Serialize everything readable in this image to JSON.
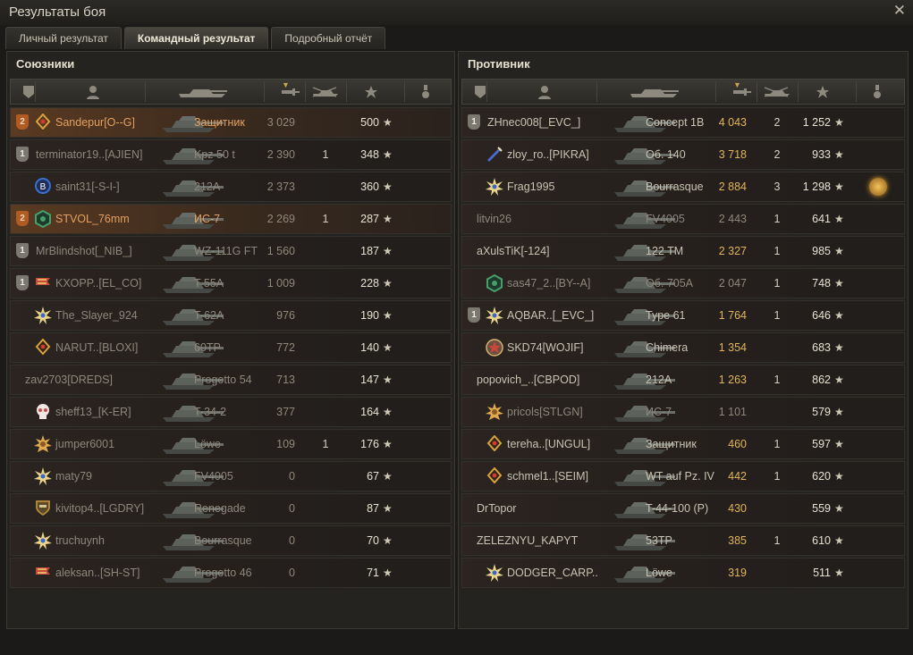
{
  "window": {
    "title": "Результаты боя",
    "close_glyph": "✕"
  },
  "tabs": [
    "Личный результат",
    "Командный результат",
    "Подробный отчёт"
  ],
  "active_tab": 1,
  "colors": {
    "accent_orange": "#e4a060",
    "damage_highlight": "#e0b55c",
    "platoon_orange": "#b05a24"
  },
  "header_icons": [
    "platoon-icon",
    "player-icon",
    "tank-icon",
    "damage-icon",
    "kills-icon",
    "xp-star-icon",
    "medal-icon"
  ],
  "allies": {
    "title": "Союзники",
    "rows": [
      {
        "platoon": "2",
        "pcolor": "orange",
        "clan_icon": "diamond-icon",
        "name": "Sandepur[O--G]",
        "vehicle": "Защитник",
        "damage": "3 029",
        "kills": "",
        "xp": "500",
        "me": true,
        "dead": false
      },
      {
        "platoon": "1",
        "pcolor": "gray",
        "clan_icon": "",
        "name": "terminator19..[AJIEN]",
        "vehicle": "Kpz 50 t",
        "damage": "2 390",
        "kills": "1",
        "xp": "348",
        "dead": true
      },
      {
        "platoon": "",
        "clan_icon": "b-circle-icon",
        "name": "saint31[-S-I-]",
        "vehicle": "212A",
        "damage": "2 373",
        "kills": "",
        "xp": "360",
        "dead": true
      },
      {
        "platoon": "2",
        "pcolor": "orange",
        "clan_icon": "hexagon-icon",
        "name": "STVOL_76mm",
        "vehicle": "ИС-7",
        "damage": "2 269",
        "kills": "1",
        "xp": "287",
        "me": true,
        "dead": false
      },
      {
        "platoon": "1",
        "pcolor": "gray",
        "clan_icon": "",
        "name": "MrBlindshot[_NIB_]",
        "vehicle": "WZ-111G FT",
        "damage": "1 560",
        "kills": "",
        "xp": "187",
        "dead": true
      },
      {
        "platoon": "1",
        "pcolor": "gray",
        "clan_icon": "flag-icon",
        "name": "KXOPP..[EL_CO]",
        "vehicle": "T 55A",
        "damage": "1 009",
        "kills": "",
        "xp": "228",
        "dead": true
      },
      {
        "platoon": "",
        "clan_icon": "star-burst-icon",
        "name": "The_Slayer_924",
        "vehicle": "T-62A",
        "damage": "976",
        "kills": "",
        "xp": "190",
        "dead": true
      },
      {
        "platoon": "",
        "clan_icon": "diamond-icon",
        "name": "NARUT..[BLOXI]",
        "vehicle": "60TP",
        "damage": "772",
        "kills": "",
        "xp": "140",
        "dead": true
      },
      {
        "platoon": "",
        "clan_icon": "",
        "name": "zav2703[DREDS]",
        "vehicle": "Progetto 54",
        "damage": "713",
        "kills": "",
        "xp": "147",
        "dead": true
      },
      {
        "platoon": "",
        "clan_icon": "skull-icon",
        "name": "sheff13_[K-ER]",
        "vehicle": "T-34-2",
        "damage": "377",
        "kills": "",
        "xp": "164",
        "dead": true
      },
      {
        "platoon": "",
        "clan_icon": "sun-icon",
        "name": "jumper6001",
        "vehicle": "Löwe",
        "damage": "109",
        "kills": "1",
        "xp": "176",
        "dead": true
      },
      {
        "platoon": "",
        "clan_icon": "star-burst-icon",
        "name": "maty79",
        "vehicle": "FV4005",
        "damage": "0",
        "kills": "",
        "xp": "67",
        "dead": true
      },
      {
        "platoon": "",
        "clan_icon": "shield-icon",
        "name": "kivitop4..[LGDRY]",
        "vehicle": "Renegade",
        "damage": "0",
        "kills": "",
        "xp": "87",
        "dead": true
      },
      {
        "platoon": "",
        "clan_icon": "star-burst-icon",
        "name": "truchuynh",
        "vehicle": "Bourrasque",
        "damage": "0",
        "kills": "",
        "xp": "70",
        "dead": true
      },
      {
        "platoon": "",
        "clan_icon": "flag-icon",
        "name": "aleksan..[SH-ST]",
        "vehicle": "Progetto 46",
        "damage": "0",
        "kills": "",
        "xp": "71",
        "dead": true
      }
    ]
  },
  "enemies": {
    "title": "Противник",
    "rows": [
      {
        "platoon": "1",
        "pcolor": "gray",
        "clan_icon": "",
        "name": "ZHnec008[_EVC_]",
        "vehicle": "Concept 1B",
        "damage": "4 043",
        "kills": "2",
        "xp": "1 252",
        "dmg_hi": true
      },
      {
        "platoon": "",
        "clan_icon": "rocket-icon",
        "name": "zloy_ro..[PIKRA]",
        "vehicle": "Об. 140",
        "damage": "3 718",
        "kills": "2",
        "xp": "933",
        "dmg_hi": true
      },
      {
        "platoon": "",
        "clan_icon": "star-burst-icon",
        "name": "Frag1995",
        "vehicle": "Bourrasque",
        "damage": "2 884",
        "kills": "3",
        "xp": "1 298",
        "dmg_hi": true,
        "medal": true
      },
      {
        "platoon": "",
        "clan_icon": "",
        "name": "litvin26",
        "vehicle": "FV4005",
        "damage": "2 443",
        "kills": "1",
        "xp": "641",
        "dead": true
      },
      {
        "platoon": "",
        "clan_icon": "",
        "name": "aXulsTiK[-124]",
        "vehicle": "122 TM",
        "damage": "2 327",
        "kills": "1",
        "xp": "985",
        "dmg_hi": true
      },
      {
        "platoon": "",
        "clan_icon": "hexagon-icon",
        "name": "sas47_2..[BY--A]",
        "vehicle": "Об. 705А",
        "damage": "2 047",
        "kills": "1",
        "xp": "748",
        "dead": true
      },
      {
        "platoon": "1",
        "pcolor": "gray",
        "clan_icon": "star-burst-icon",
        "name": "AQBAR..[_EVC_]",
        "vehicle": "Type 61",
        "damage": "1 764",
        "kills": "1",
        "xp": "646",
        "dmg_hi": true
      },
      {
        "platoon": "",
        "clan_icon": "star-red-icon",
        "name": "SKD74[WOJIF]",
        "vehicle": "Chimera",
        "damage": "1 354",
        "kills": "",
        "xp": "683",
        "dmg_hi": true
      },
      {
        "platoon": "",
        "clan_icon": "",
        "name": "popovich_..[CBPOD]",
        "vehicle": "212A",
        "damage": "1 263",
        "kills": "1",
        "xp": "862",
        "dmg_hi": true
      },
      {
        "platoon": "",
        "clan_icon": "sun-icon",
        "name": "pricols[STLGN]",
        "vehicle": "ИС-7",
        "damage": "1 101",
        "kills": "",
        "xp": "579",
        "dead": true
      },
      {
        "platoon": "",
        "clan_icon": "diamond-icon",
        "name": "tereha..[UNGUL]",
        "vehicle": "Защитник",
        "damage": "460",
        "kills": "1",
        "xp": "597",
        "dmg_hi": true
      },
      {
        "platoon": "",
        "clan_icon": "diamond-icon",
        "name": "schmel1..[SEIM]",
        "vehicle": "WT auf Pz. IV",
        "damage": "442",
        "kills": "1",
        "xp": "620",
        "dmg_hi": true
      },
      {
        "platoon": "",
        "clan_icon": "",
        "name": "DrTopor",
        "vehicle": "T-44-100 (P)",
        "damage": "430",
        "kills": "",
        "xp": "559",
        "dmg_hi": true
      },
      {
        "platoon": "",
        "clan_icon": "",
        "name": "ZELEZNYU_KAPYT",
        "vehicle": "53TP",
        "damage": "385",
        "kills": "1",
        "xp": "610",
        "dmg_hi": true
      },
      {
        "platoon": "",
        "clan_icon": "star-burst-icon",
        "name": "DODGER_CARP..",
        "vehicle": "Löwe",
        "damage": "319",
        "kills": "",
        "xp": "511",
        "dmg_hi": true
      }
    ]
  }
}
